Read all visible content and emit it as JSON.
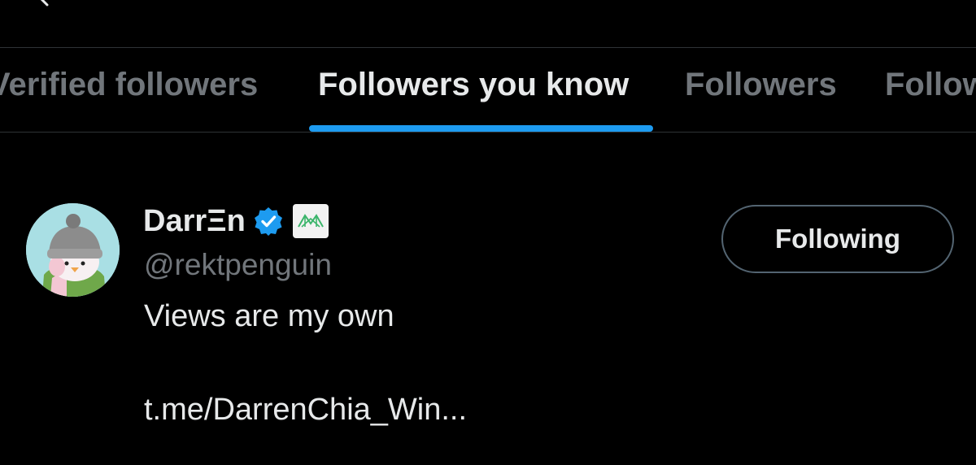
{
  "header": {
    "title_fragment": "",
    "back_icon": "arrow-left-icon",
    "add_user_icon": "add-user-icon"
  },
  "tabs": [
    {
      "label": "Verified followers",
      "active": false
    },
    {
      "label": "Followers you know",
      "active": true
    },
    {
      "label": "Followers",
      "active": false
    },
    {
      "label": "Following",
      "active": false
    }
  ],
  "colors": {
    "background": "#000000",
    "text_primary": "#e7e9ea",
    "text_secondary": "#71767b",
    "accent": "#1d9bf0",
    "divider": "#2f3336"
  },
  "user": {
    "display_name": "DarrΞn",
    "handle": "@rektpenguin",
    "bio": "Views are my own",
    "bio_link": "t.me/DarrenChia_Win...",
    "verified_icon": "verified-badge-icon",
    "affiliate_icon": "affiliate-badge-icon",
    "follow_state_label": "Following"
  }
}
